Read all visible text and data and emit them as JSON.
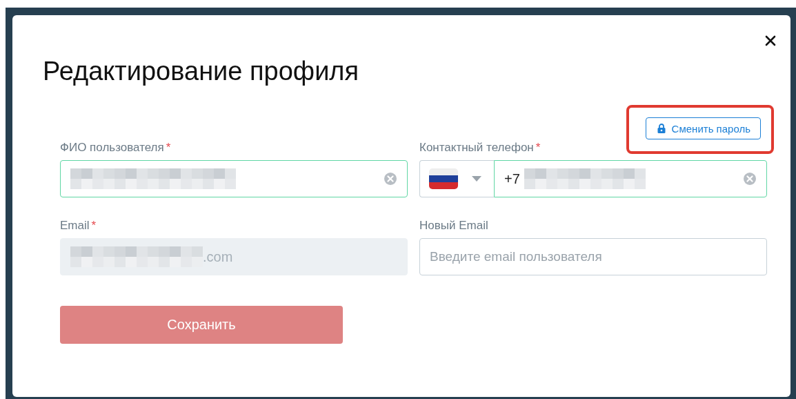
{
  "dialog": {
    "title": "Редактирование профиля",
    "change_password": {
      "label": "Сменить пароль",
      "highlighted": true
    },
    "fields": [
      {
        "kind": "text",
        "label": "ФИО пользователя",
        "required_mark": "*",
        "valid": true,
        "disabled": false
      },
      {
        "kind": "phone",
        "label": "Контактный телефон",
        "required_mark": "*",
        "valid": true,
        "disabled": false,
        "prefix": "+7"
      },
      {
        "kind": "text",
        "label": "Email",
        "required_mark": "*",
        "valid": false,
        "disabled": true,
        "value_suffix": ".com"
      },
      {
        "kind": "empty",
        "label": "Новый Email",
        "valid": false,
        "disabled": false,
        "placeholder": "Введите email пользователя"
      }
    ],
    "save": {
      "label": "Сохранить",
      "disabled": true
    }
  }
}
